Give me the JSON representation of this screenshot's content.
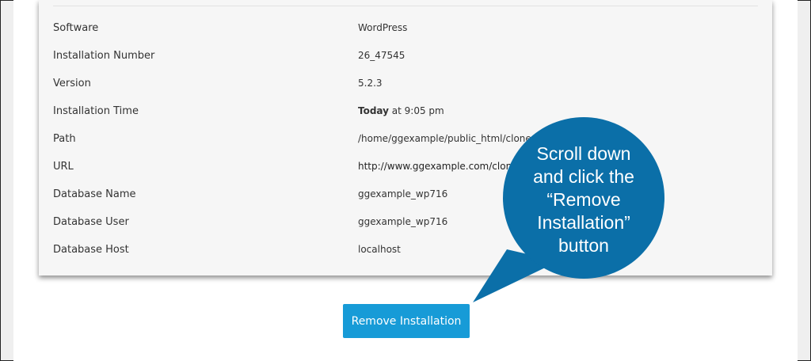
{
  "details": {
    "rows": [
      {
        "label": "Software",
        "value": "WordPress"
      },
      {
        "label": "Installation Number",
        "value": "26_47545"
      },
      {
        "label": "Version",
        "value": "5.2.3"
      },
      {
        "label": "Installation Time",
        "value_bold": "Today",
        "value": " at 9:05 pm"
      },
      {
        "label": "Path",
        "value": "/home/ggexample/public_html/clone"
      },
      {
        "label": "URL",
        "value": "http://www.ggexample.com/clone"
      },
      {
        "label": "Database Name",
        "value": "ggexample_wp716"
      },
      {
        "label": "Database User",
        "value": "ggexample_wp716"
      },
      {
        "label": "Database Host",
        "value": "localhost"
      }
    ]
  },
  "actions": {
    "remove_label": "Remove Installation"
  },
  "callout": {
    "text_lines": [
      "Scroll down",
      "and click the",
      "“Remove",
      "Installation”",
      "button"
    ],
    "color": "#0b6fa8"
  },
  "colors": {
    "button": "#179bd7",
    "card_bg": "#f6f6f6"
  }
}
